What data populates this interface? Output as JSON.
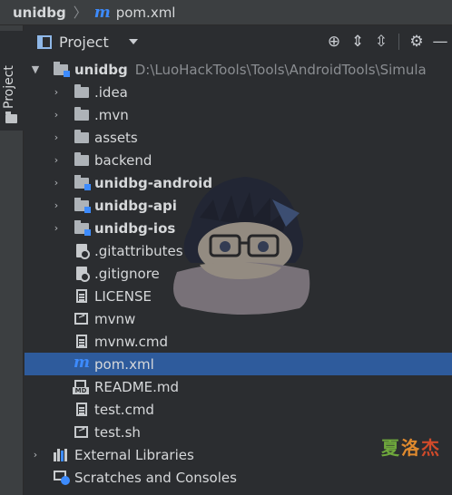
{
  "breadcrumb": {
    "project": "unidbg",
    "file_icon": "maven-m-icon",
    "file": "pom.xml"
  },
  "tool_strip": {
    "tab_label": "Project",
    "icon": "folder-icon"
  },
  "panel": {
    "title": "Project",
    "icons": [
      "locate-icon",
      "expand-all-icon",
      "collapse-all-icon",
      "gear-icon",
      "hide-icon"
    ]
  },
  "tree": {
    "root": {
      "name": "unidbg",
      "path": "D:\\LuoHackTools\\Tools\\AndroidTools\\Simula"
    },
    "children": [
      {
        "name": ".idea",
        "kind": "folder"
      },
      {
        "name": ".mvn",
        "kind": "folder"
      },
      {
        "name": "assets",
        "kind": "folder"
      },
      {
        "name": "backend",
        "kind": "folder"
      },
      {
        "name": "unidbg-android",
        "kind": "module"
      },
      {
        "name": "unidbg-api",
        "kind": "module"
      },
      {
        "name": "unidbg-ios",
        "kind": "module"
      },
      {
        "name": ".gitattributes",
        "kind": "git"
      },
      {
        "name": ".gitignore",
        "kind": "git"
      },
      {
        "name": "LICENSE",
        "kind": "text"
      },
      {
        "name": "mvnw",
        "kind": "shell"
      },
      {
        "name": "mvnw.cmd",
        "kind": "text"
      },
      {
        "name": "pom.xml",
        "kind": "maven",
        "selected": true
      },
      {
        "name": "README.md",
        "kind": "md"
      },
      {
        "name": "test.cmd",
        "kind": "text"
      },
      {
        "name": "test.sh",
        "kind": "shell"
      }
    ],
    "external_libraries": "External Libraries",
    "scratches": "Scratches and Consoles"
  },
  "colors": {
    "background": "#2b2d30",
    "selection": "#2e5b9c",
    "accent": "#3d8bfd"
  }
}
